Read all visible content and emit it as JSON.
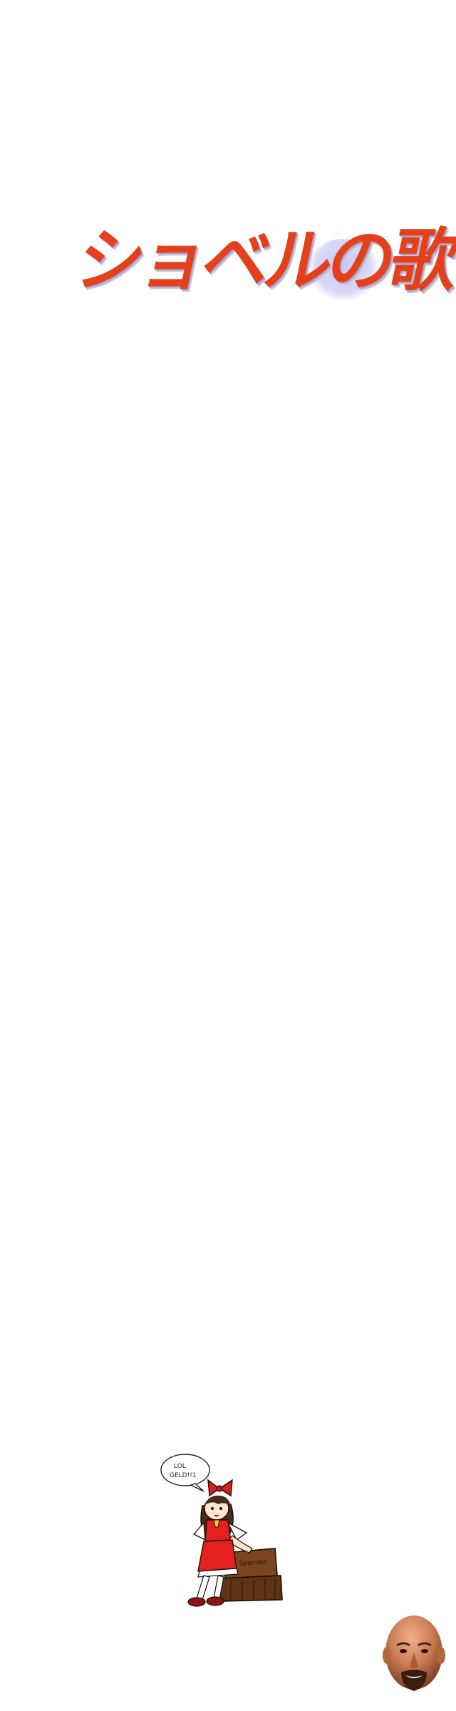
{
  "title": {
    "text": "ショベルの歌"
  },
  "mascot": {
    "speech_bubble_line1": "LOL",
    "speech_bubble_line2": "GELD!!1",
    "crate_label": "Spenden"
  },
  "colors": {
    "title_red": "#e5401c",
    "title_orange": "#f0701c",
    "title_shadow": "#c9c8f0",
    "dress_red": "#e52020",
    "crate_brown": "#6b3d1a"
  }
}
